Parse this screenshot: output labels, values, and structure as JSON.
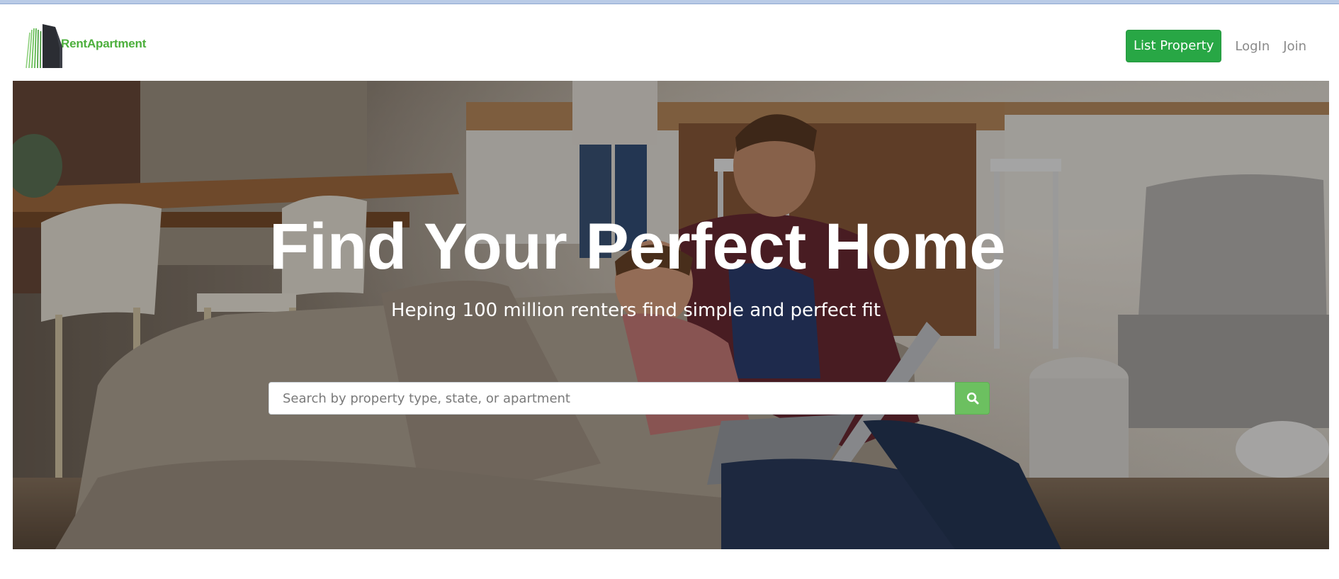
{
  "brand": {
    "name": "RentApartment",
    "color": "#4caf3c"
  },
  "nav": {
    "list_property_label": "List Property",
    "login_label": "LogIn",
    "join_label": "Join",
    "button_color": "#28a745"
  },
  "hero": {
    "title": "Find Your Perfect Home",
    "subtitle": "Heping 100 million renters find simple and perfect fit",
    "background": "family-living-room-photo"
  },
  "search": {
    "placeholder": "Search by property type, state, or apartment",
    "value": "",
    "button_icon": "search-icon",
    "button_color": "#6cc060"
  }
}
